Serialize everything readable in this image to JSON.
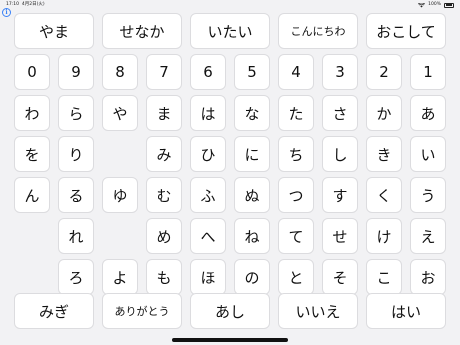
{
  "status_bar": {
    "time": "17:10",
    "date": "4月2日(火)",
    "battery": "100%"
  },
  "info_icon": "i",
  "phrases_top": [
    "やま",
    "せなか",
    "いたい",
    "こんにちわ",
    "おこして"
  ],
  "phrases_bottom": [
    "みぎ",
    "ありがとう",
    "あし",
    "いいえ",
    "はい"
  ],
  "grid": [
    [
      "0",
      "9",
      "8",
      "7",
      "6",
      "5",
      "4",
      "3",
      "2",
      "1"
    ],
    [
      "わ",
      "ら",
      "や",
      "ま",
      "は",
      "な",
      "た",
      "さ",
      "か",
      "あ"
    ],
    [
      "を",
      "り",
      "",
      "み",
      "ひ",
      "に",
      "ち",
      "し",
      "き",
      "い"
    ],
    [
      "ん",
      "る",
      "ゆ",
      "む",
      "ふ",
      "ぬ",
      "つ",
      "す",
      "く",
      "う"
    ],
    [
      "",
      "れ",
      "",
      "め",
      "へ",
      "ね",
      "て",
      "せ",
      "け",
      "え"
    ],
    [
      "",
      "ろ",
      "よ",
      "も",
      "ほ",
      "の",
      "と",
      "そ",
      "こ",
      "お"
    ]
  ]
}
